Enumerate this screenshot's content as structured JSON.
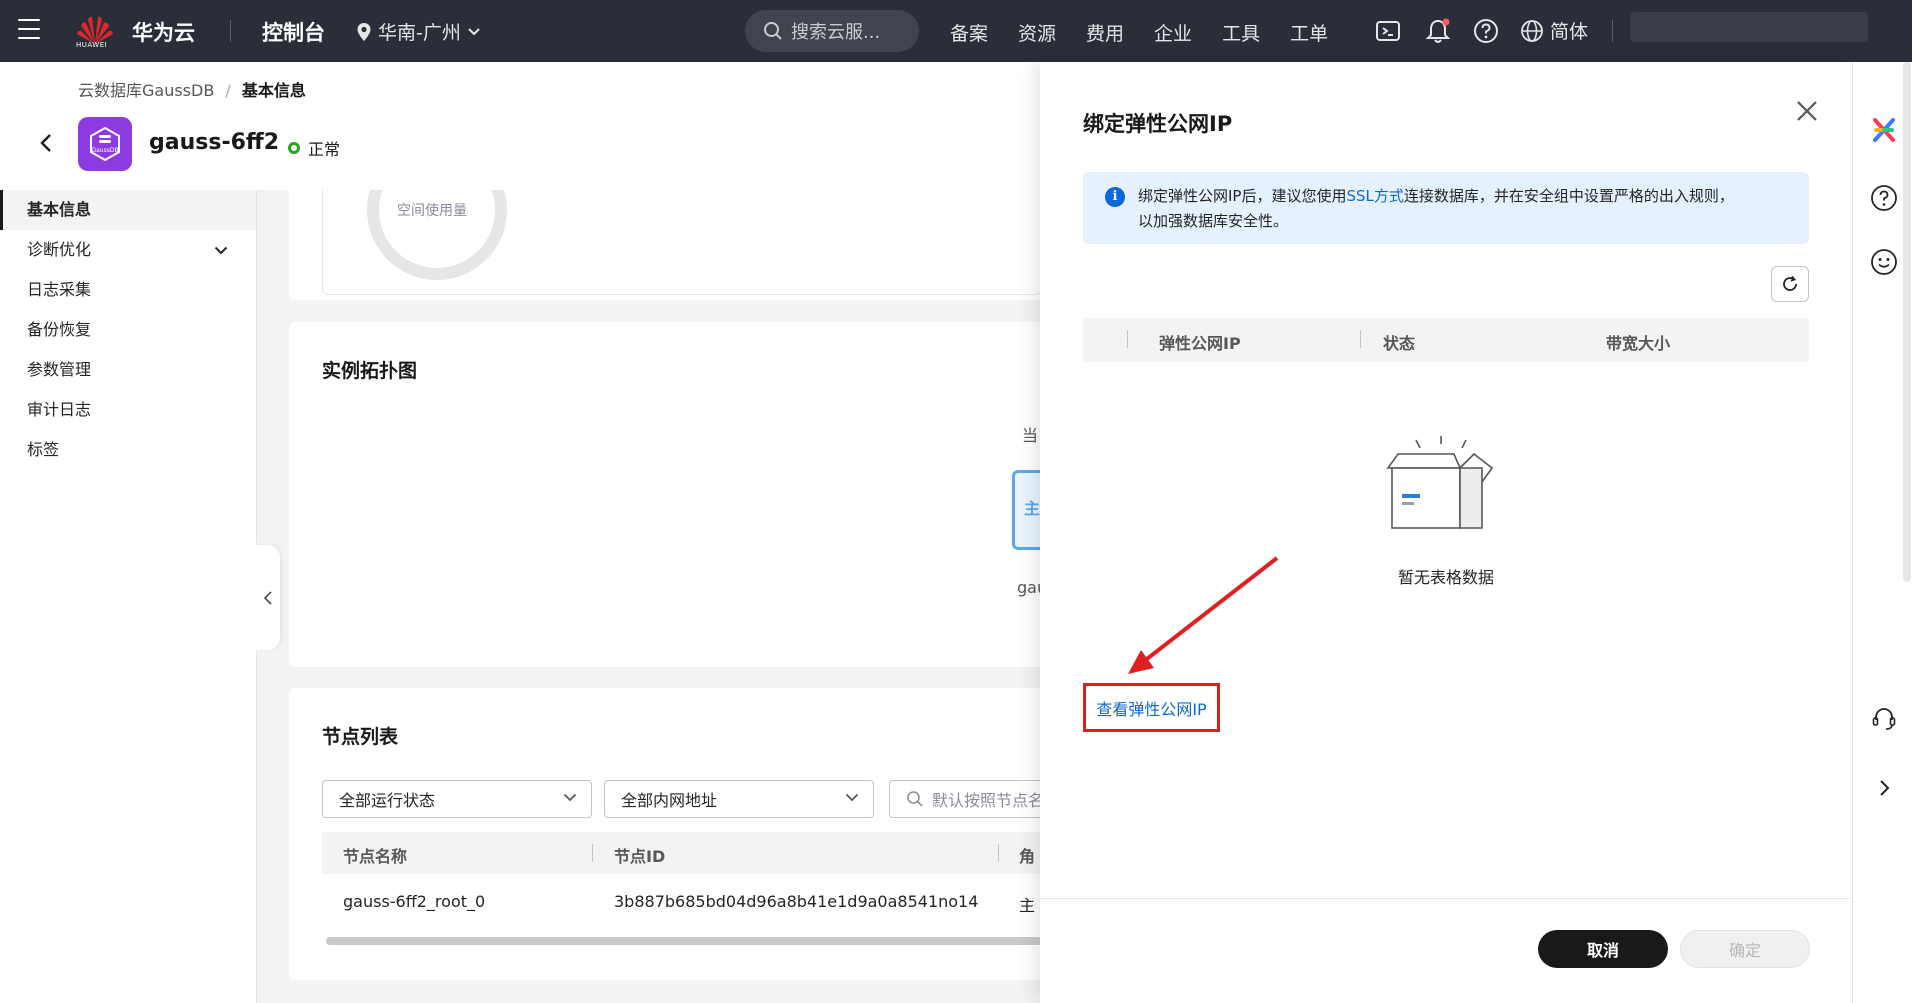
{
  "topbar": {
    "logo_text": "HUAWEI",
    "brand": "华为云",
    "console": "控制台",
    "region": "华南-广州",
    "search_placeholder": "搜索云服...",
    "nav": [
      "备案",
      "资源",
      "费用",
      "企业",
      "工具",
      "工单"
    ],
    "lang": "简体",
    "notification_dot_color": "#ff5b5b"
  },
  "breadcrumb": {
    "parent": "云数据库GaussDB",
    "separator": "/",
    "current": "基本信息"
  },
  "instance": {
    "logo_text": "GaussDB",
    "name": "gauss-6ff2",
    "status": "正常"
  },
  "sidebar": {
    "items": [
      {
        "label": "基本信息",
        "active": true
      },
      {
        "label": "诊断优化",
        "has_children": true
      },
      {
        "label": "日志采集"
      },
      {
        "label": "备份恢复"
      },
      {
        "label": "参数管理"
      },
      {
        "label": "审计日志"
      },
      {
        "label": "标签"
      }
    ]
  },
  "main": {
    "gauge_label": "空间使用量",
    "topology": {
      "title": "实例拓扑图",
      "partial_text": "当",
      "node_text": "主",
      "node_label": "gau"
    },
    "nodes": {
      "title": "节点列表",
      "filter_status": "全部运行状态",
      "filter_address": "全部内网地址",
      "search_placeholder": "默认按照节点名",
      "columns": [
        "节点名称",
        "节点ID",
        "角"
      ],
      "rows": [
        {
          "name": "gauss-6ff2_root_0",
          "id": "3b887b685bd04d96a8b41e1d9a0a8541no14",
          "role": "主"
        }
      ]
    }
  },
  "drawer": {
    "title": "绑定弹性公网IP",
    "notice_pre": "绑定弹性公网IP后，建议您使用",
    "notice_link": "SSL方式",
    "notice_post": "连接数据库，并在安全组中设置严格的出入规则，",
    "notice_line2": "以加强数据库安全性。",
    "columns": [
      "弹性公网IP",
      "状态",
      "带宽大小"
    ],
    "empty_text": "暂无表格数据",
    "view_link": "查看弹性公网IP",
    "cancel": "取消",
    "confirm": "确定"
  },
  "colors": {
    "topbar": "#2a2e39",
    "link": "#0d68d7",
    "notice_bg": "#e5f1fe",
    "annotation": "#e02020",
    "status_ok": "#2ea121",
    "gaussdb_purple": "#8d3ae0"
  }
}
